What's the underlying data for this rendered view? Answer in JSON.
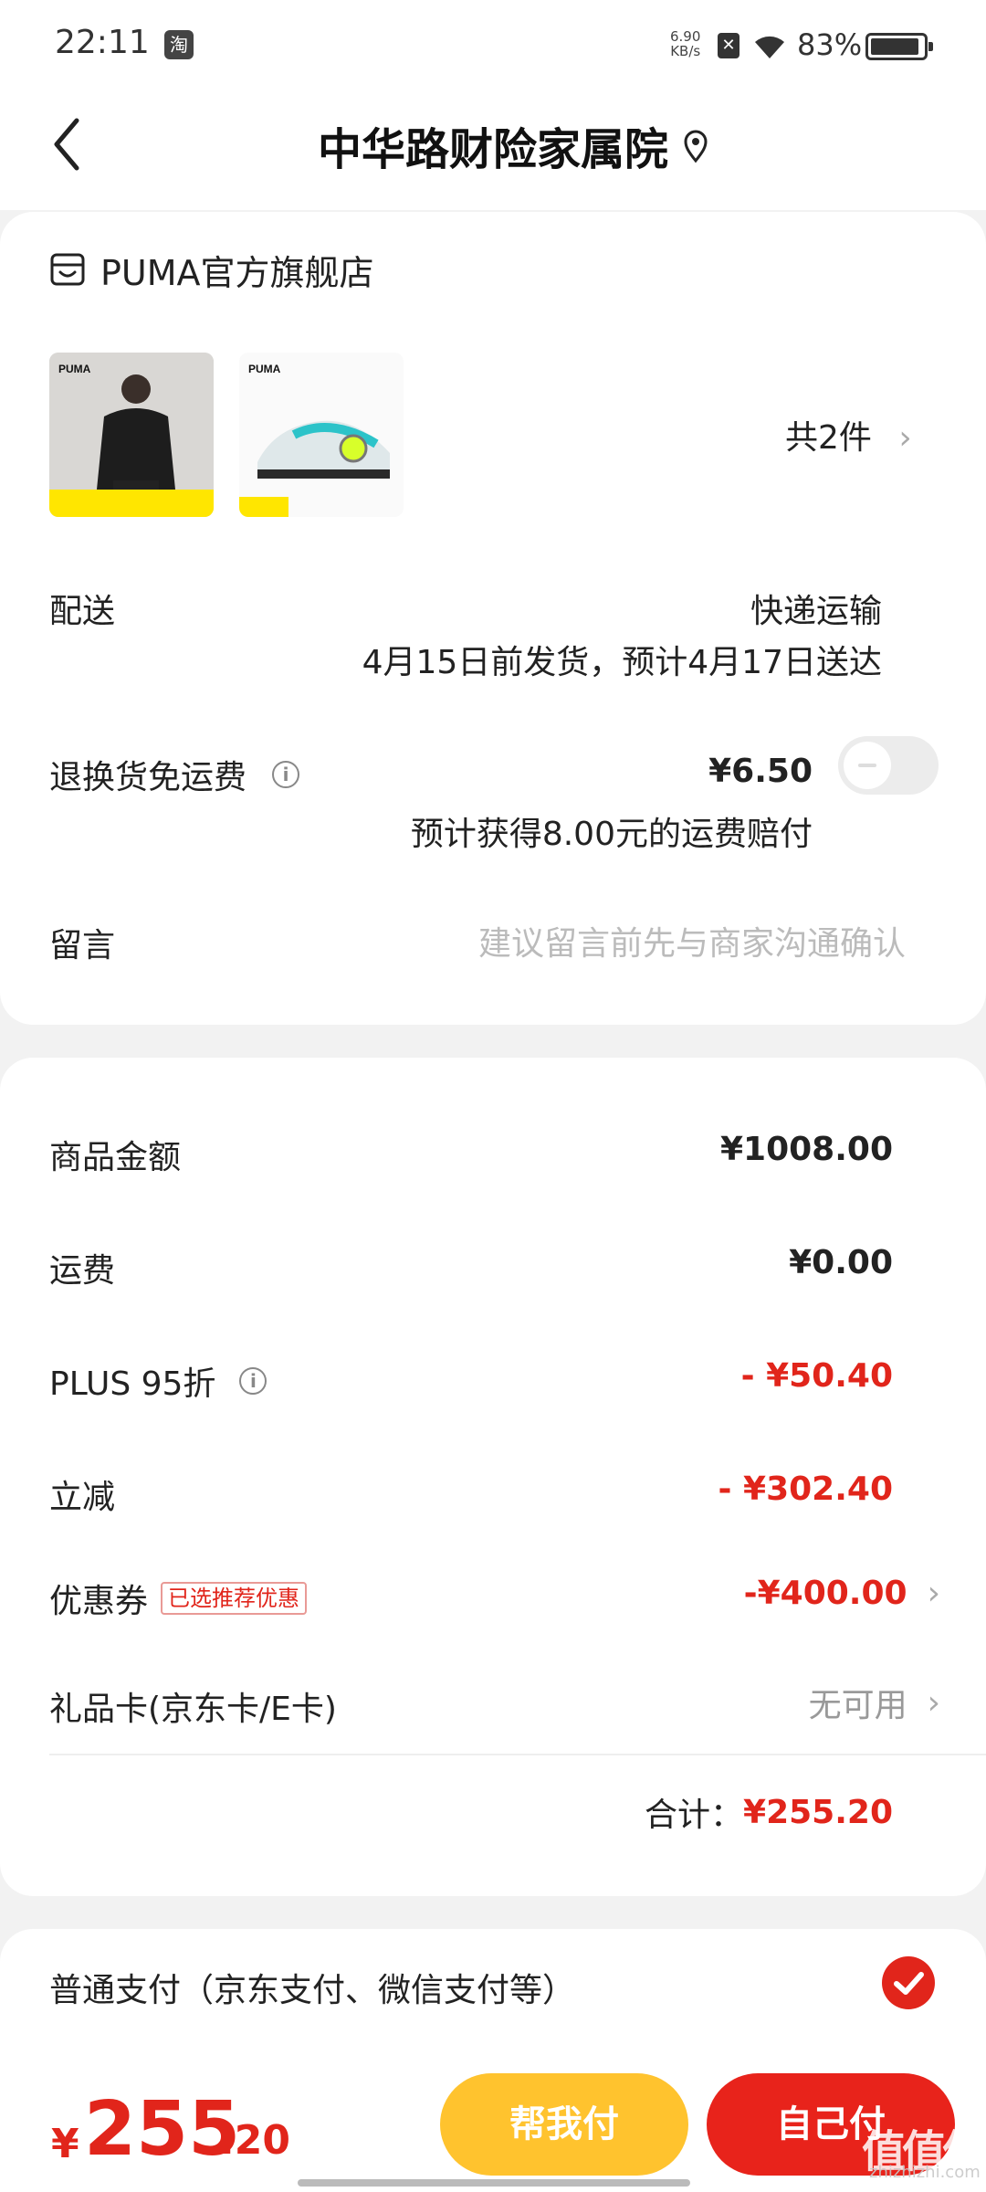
{
  "status_bar": {
    "time": "22:11",
    "app_icon": "淘",
    "net_speed_value": "6.90",
    "net_speed_unit": "KB/s",
    "battery": "83%",
    "battery_level": 0.83
  },
  "header": {
    "title": "中华路财险家属院"
  },
  "store": {
    "name": "PUMA官方旗舰店",
    "item_count": "共2件"
  },
  "delivery": {
    "label": "配送",
    "method": "快递运输",
    "eta": "4月15日前发货，预计4月17日送达"
  },
  "return_shipping": {
    "label": "退换货免运费",
    "price": "¥6.50",
    "note": "预计获得8.00元的运费赔付",
    "enabled": false
  },
  "message": {
    "label": "留言",
    "placeholder": "建议留言前先与商家沟通确认"
  },
  "summary": {
    "goods_label": "商品金额",
    "goods_value": "¥1008.00",
    "shipping_label": "运费",
    "shipping_value": "¥0.00",
    "plus_label": "PLUS 95折",
    "plus_value": "- ¥50.40",
    "instant_label": "立减",
    "instant_value": "- ¥302.40",
    "coupon_label": "优惠券",
    "coupon_badge": "已选推荐优惠",
    "coupon_value": "-¥400.00",
    "giftcard_label": "礼品卡(京东卡/E卡)",
    "giftcard_value": "无可用",
    "total_label": "合计：",
    "total_value": "¥255.20"
  },
  "payment": {
    "method": "普通支付（京东支付、微信支付等）",
    "selected": true
  },
  "bottom_bar": {
    "currency": "¥",
    "total_int": "255",
    "total_dec": ".20",
    "help_pay": "帮我付",
    "self_pay": "自己付"
  },
  "watermark": {
    "text": "值值值",
    "url": "zhizhizhi.com"
  },
  "colors": {
    "accent_red": "#e1251b",
    "help_yellow": "#ffc32e"
  }
}
